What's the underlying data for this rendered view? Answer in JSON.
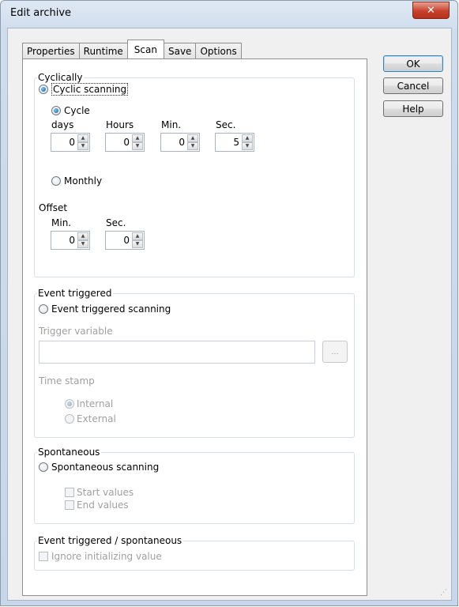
{
  "window": {
    "title": "Edit archive",
    "close_glyph": "✕"
  },
  "tabs": [
    {
      "label": "Properties",
      "active": false
    },
    {
      "label": "Runtime",
      "active": false
    },
    {
      "label": "Scan",
      "active": true
    },
    {
      "label": "Save",
      "active": false
    },
    {
      "label": "Options",
      "active": false
    }
  ],
  "buttons": {
    "ok": "OK",
    "cancel": "Cancel",
    "help": "Help"
  },
  "cyclically": {
    "group_title": "Cyclically",
    "cyclic_scanning_label": "Cyclic scanning",
    "cyclic_scanning_selected": true,
    "cycle_label": "Cycle",
    "cycle_selected": true,
    "days_label": "days",
    "hours_label": "Hours",
    "min_label": "Min.",
    "sec_label": "Sec.",
    "days_value": "0",
    "hours_value": "0",
    "min_value": "0",
    "sec_value": "5",
    "monthly_label": "Monthly",
    "monthly_selected": false,
    "offset_label": "Offset",
    "offset_min_label": "Min.",
    "offset_sec_label": "Sec.",
    "offset_min_value": "0",
    "offset_sec_value": "0"
  },
  "event_triggered": {
    "group_title": "Event triggered",
    "scanning_label": "Event triggered scanning",
    "scanning_selected": false,
    "trigger_variable_label": "Trigger variable",
    "trigger_variable_value": "",
    "browse_label": "...",
    "time_stamp_label": "Time stamp",
    "internal_label": "Internal",
    "internal_selected": true,
    "external_label": "External",
    "external_selected": false
  },
  "spontaneous": {
    "group_title": "Spontaneous",
    "scanning_label": "Spontaneous scanning",
    "scanning_selected": false,
    "start_values_label": "Start values",
    "start_values_checked": false,
    "end_values_label": "End values",
    "end_values_checked": false
  },
  "event_spontaneous": {
    "group_title": "Event triggered / spontaneous",
    "ignore_label": "Ignore initializing value",
    "ignore_checked": false
  },
  "icons": {
    "spin_up": "▲",
    "spin_down": "▼",
    "resize_grip": "⋰"
  }
}
